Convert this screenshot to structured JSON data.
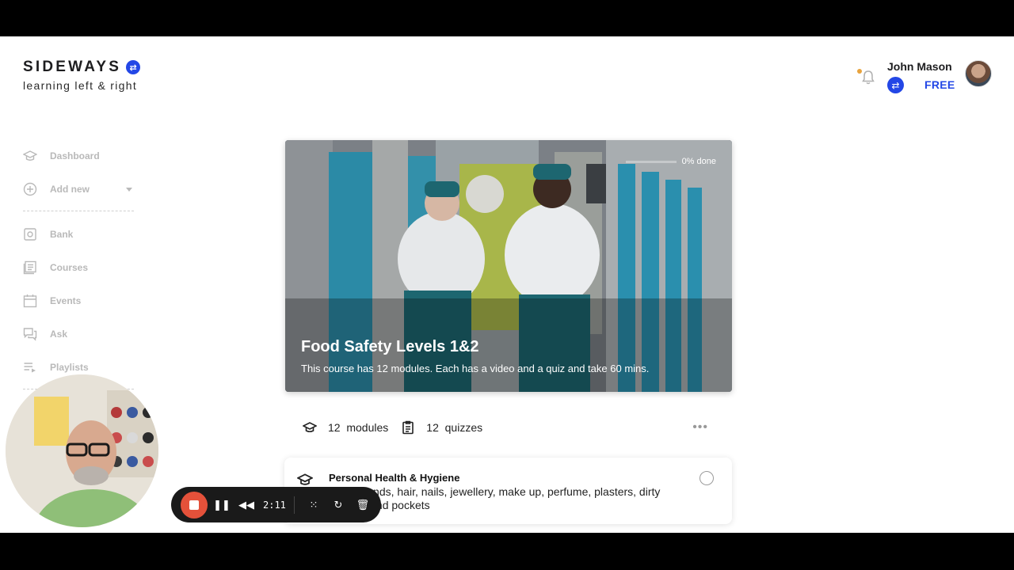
{
  "brand": {
    "name": "SIDEWAYS",
    "tagline": "learning left & right",
    "badge_icon": "swap-arrows-icon",
    "accent": "#2347e6"
  },
  "user": {
    "name": "John Mason",
    "plan": "FREE",
    "notification_dot_color": "#e8a33d"
  },
  "sidebar": {
    "items": [
      {
        "label": "Dashboard",
        "icon": "graduation-cap-icon"
      },
      {
        "label": "Add new",
        "icon": "plus-circle-icon"
      },
      {
        "label": "Bank",
        "icon": "safe-icon"
      },
      {
        "label": "Courses",
        "icon": "courses-icon"
      },
      {
        "label": "Events",
        "icon": "calendar-icon"
      },
      {
        "label": "Ask",
        "icon": "chat-icon"
      },
      {
        "label": "Playlists",
        "icon": "playlist-icon"
      }
    ]
  },
  "course": {
    "title": "Food Safety Levels 1&2",
    "description": "This course has 12 modules. Each has a video and a quiz and take 60 mins.",
    "progress_label": "0% done",
    "progress": 0,
    "modules_count": "12",
    "modules_label": "modules",
    "quizzes_count": "12",
    "quizzes_label": "quizzes"
  },
  "modules": [
    {
      "title": "Personal Health & Hygiene",
      "description": "Clean hands, hair, nails, jewellery, make up, perfume, plasters, dirty clothing and pockets"
    }
  ],
  "recorder": {
    "time": "2:11",
    "stop_color": "#e4513a"
  }
}
